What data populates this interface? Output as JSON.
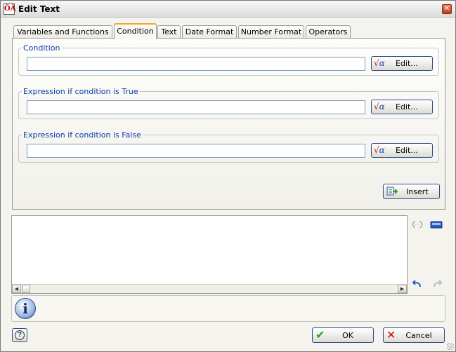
{
  "window": {
    "title": "Edit Text",
    "close_glyph": "✕",
    "app_icon_text": "ŌĀ"
  },
  "tabs": [
    {
      "label": "Variables and Functions",
      "active": false
    },
    {
      "label": "Condition",
      "active": true
    },
    {
      "label": "Text",
      "active": false
    },
    {
      "label": "Date Format",
      "active": false
    },
    {
      "label": "Number Format",
      "active": false
    },
    {
      "label": "Operators",
      "active": false
    }
  ],
  "condition_tab": {
    "groups": [
      {
        "legend": "Condition",
        "value": "",
        "edit_label": "Edit..."
      },
      {
        "legend": "Expression if condition is True",
        "value": "",
        "edit_label": "Edit..."
      },
      {
        "legend": "Expression if condition is False",
        "value": "",
        "edit_label": "Edit..."
      }
    ],
    "insert_label": "Insert"
  },
  "preview": {
    "text": ""
  },
  "footer": {
    "info_glyph": "i",
    "help_glyph": "?",
    "ok_label": "OK",
    "cancel_label": "Cancel"
  },
  "colors": {
    "legend": "#0a3ca8",
    "tab_accent": "#f5a623",
    "ok_check": "#2aa02a",
    "cancel_x": "#d01010"
  }
}
